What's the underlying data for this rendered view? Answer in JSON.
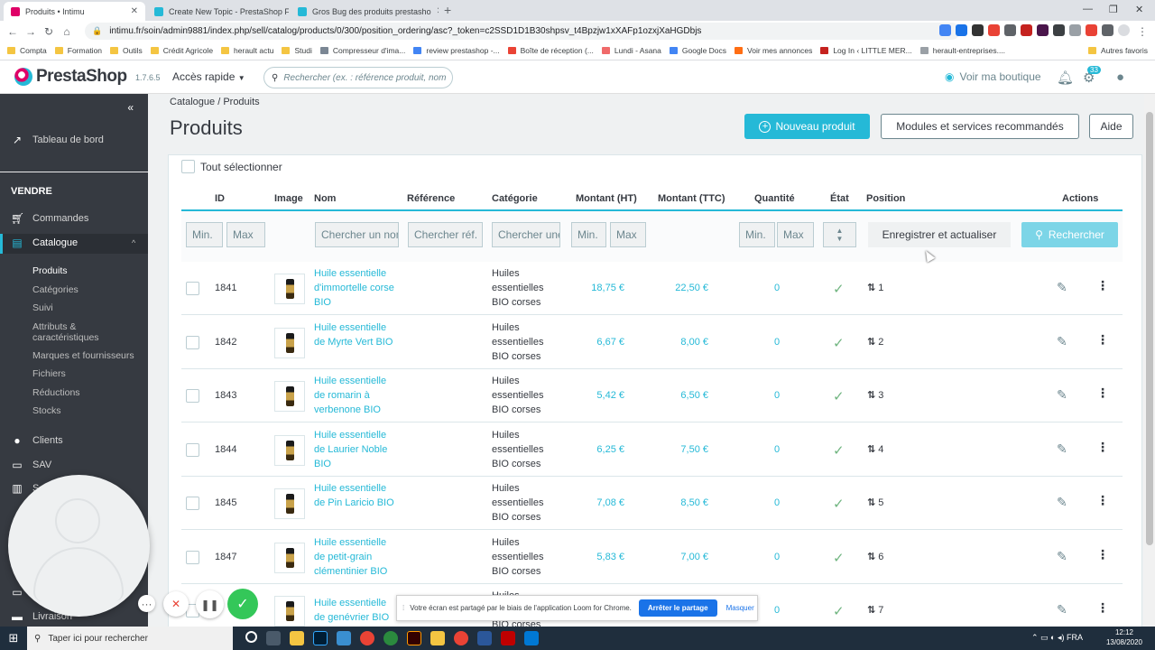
{
  "browser": {
    "tabs": [
      {
        "title": "Produits • Intimu",
        "fav_color": "#df0067"
      },
      {
        "title": "Create New Topic - PrestaShop F",
        "fav_color": "#25b9d7"
      },
      {
        "title": "Gros Bug des produits prestasho",
        "fav_color": "#25b9d7"
      }
    ],
    "url": "intimu.fr/soin/admin9881/index.php/sell/catalog/products/0/300/position_ordering/asc?_token=c2SSD1D1B30shpsv_t4Bpzjw1xXAFp1ozxjXaHGDbjs",
    "bookmarks": [
      "Compta",
      "Formation",
      "Outils",
      "Crédit Agricole",
      "herault actu",
      "Studi",
      "Compresseur d'ima...",
      "review prestashop -...",
      "Boîte de réception (...",
      "Lundi - Asana",
      "Google Docs",
      "Voir mes annonces",
      "Log In ‹ LITTLE MER...",
      "herault-entreprises....",
      "Autres favoris"
    ]
  },
  "header": {
    "logo_text": "PrestaShop",
    "version": "1.7.6.5",
    "quick_access": "Accès rapide",
    "search_placeholder": "Rechercher (ex. : référence produit, nom",
    "view_shop": "Voir ma boutique",
    "notif_count": "33"
  },
  "sidebar": {
    "dashboard": "Tableau de bord",
    "section_sell": "VENDRE",
    "orders": "Commandes",
    "catalog": "Catalogue",
    "sub": [
      "Produits",
      "Catégories",
      "Suivi",
      "Attributs & caractéristiques",
      "Marques et fournisseurs",
      "Fichiers",
      "Réductions",
      "Stocks"
    ],
    "clients": "Clients",
    "sav": "SAV",
    "stats_initial": "S",
    "delivery": "Livraison"
  },
  "main": {
    "breadcrumb": "Catalogue  /  Produits",
    "title": "Produits",
    "new_product": "Nouveau produit",
    "modules": "Modules et services recommandés",
    "help": "Aide",
    "select_all": "Tout sélectionner",
    "columns": [
      "ID",
      "Image",
      "Nom",
      "Référence",
      "Catégorie",
      "Montant (HT)",
      "Montant (TTC)",
      "Quantité",
      "État",
      "Position",
      "Actions"
    ],
    "filters": {
      "min": "Min.",
      "max": "Max",
      "name": "Chercher un nom",
      "ref": "Chercher réf.",
      "cat": "Chercher une catégorie",
      "save": "Enregistrer et actualiser",
      "search": "Rechercher"
    },
    "rows": [
      {
        "id": "1841",
        "name": "Huile essentielle d'immortelle corse BIO",
        "cat": "Huiles essentielles BIO corses",
        "ht": "18,75 €",
        "ttc": "22,50 €",
        "qty": "0",
        "pos": "1"
      },
      {
        "id": "1842",
        "name": "Huile essentielle de Myrte Vert BIO",
        "cat": "Huiles essentielles BIO corses",
        "ht": "6,67 €",
        "ttc": "8,00 €",
        "qty": "0",
        "pos": "2"
      },
      {
        "id": "1843",
        "name": "Huile essentielle de romarin à verbenone BIO",
        "cat": "Huiles essentielles BIO corses",
        "ht": "5,42 €",
        "ttc": "6,50 €",
        "qty": "0",
        "pos": "3"
      },
      {
        "id": "1844",
        "name": "Huile essentielle de Laurier Noble BIO",
        "cat": "Huiles essentielles BIO corses",
        "ht": "6,25 €",
        "ttc": "7,50 €",
        "qty": "0",
        "pos": "4"
      },
      {
        "id": "1845",
        "name": "Huile essentielle de Pin Laricio BIO",
        "cat": "Huiles essentielles BIO corses",
        "ht": "7,08 €",
        "ttc": "8,50 €",
        "qty": "0",
        "pos": "5"
      },
      {
        "id": "1847",
        "name": "Huile essentielle de petit-grain clémentinier BIO",
        "cat": "Huiles essentielles BIO corses",
        "ht": "5,83 €",
        "ttc": "7,00 €",
        "qty": "0",
        "pos": "6"
      },
      {
        "id": "",
        "name": "Huile essentielle de genévrier BIO",
        "cat": "Huiles essentielles BIO corses",
        "ht": "",
        "ttc": "",
        "qty": "0",
        "pos": "7"
      }
    ]
  },
  "loom": {
    "share_text": "Votre écran est partagé par le biais de l'application Loom for Chrome.",
    "stop": "Arrêter le partage",
    "hide": "Masquer"
  },
  "taskbar": {
    "search": "Taper ici pour rechercher",
    "time": "12:12",
    "date": "13/08/2020"
  }
}
